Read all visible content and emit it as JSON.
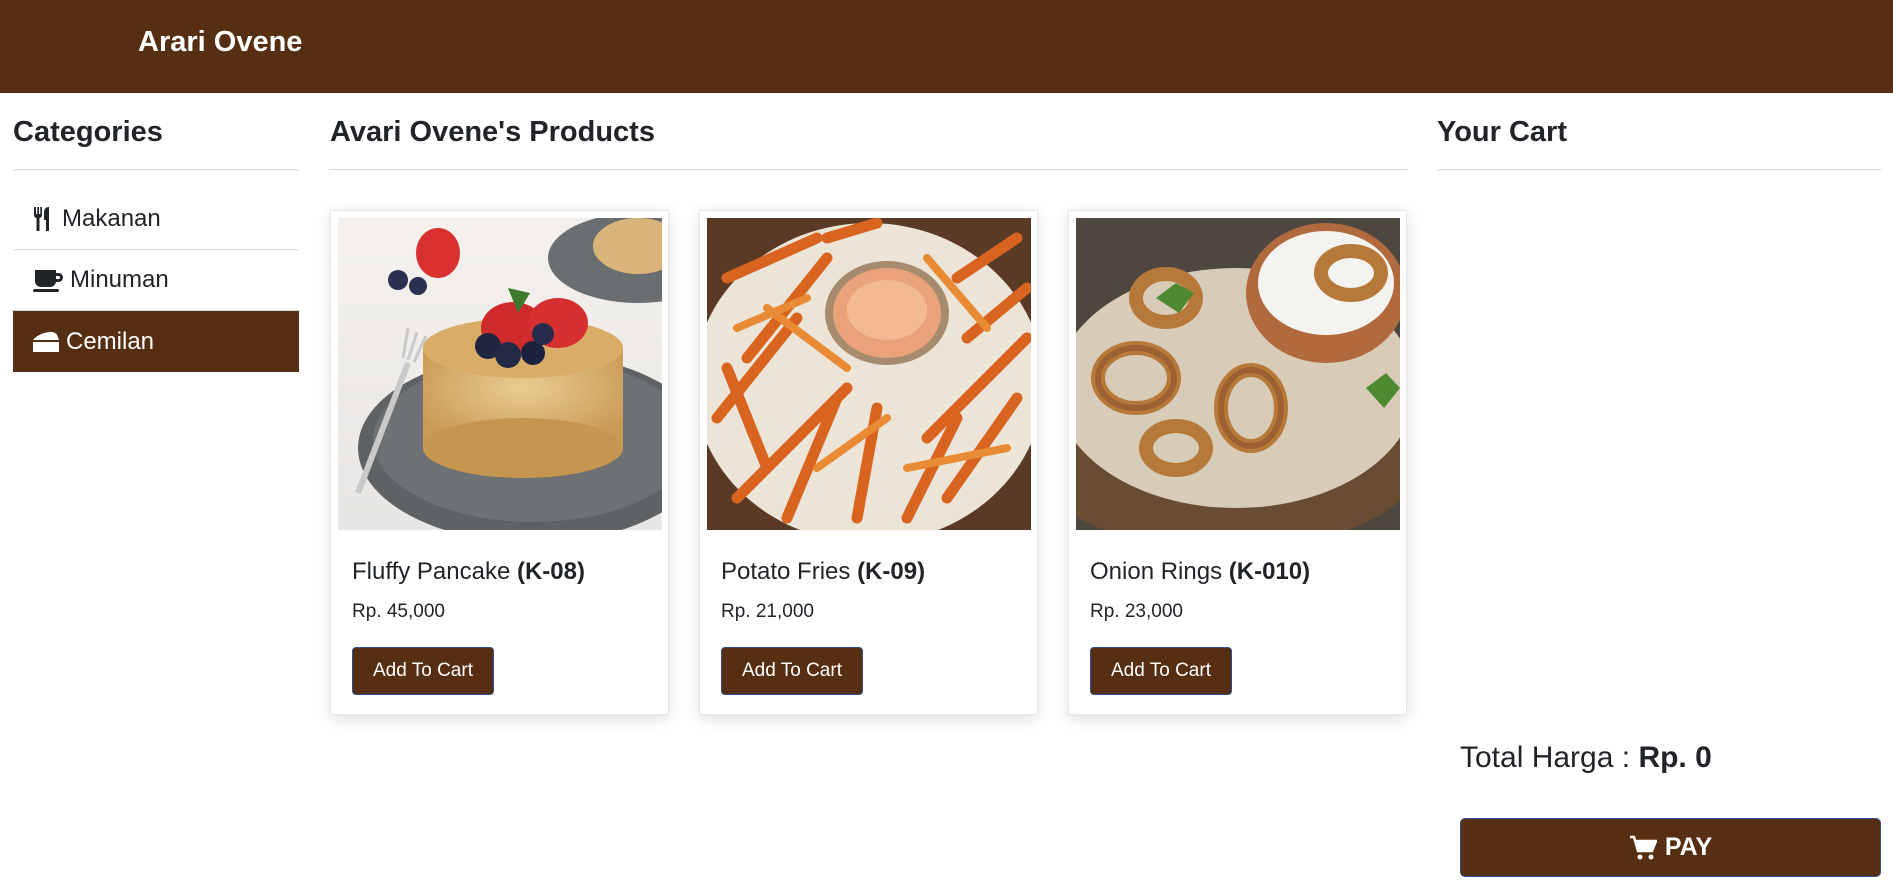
{
  "navbar": {
    "brand": "Arari Ovene"
  },
  "categories": {
    "title": "Categories",
    "items": [
      {
        "label": "Makanan",
        "icon": "utensils-icon",
        "active": false
      },
      {
        "label": "Minuman",
        "icon": "coffee-cup-icon",
        "active": false
      },
      {
        "label": "Cemilan",
        "icon": "cake-icon",
        "active": true
      }
    ]
  },
  "products": {
    "title": "Avari Ovene's Products",
    "items": [
      {
        "name": "Fluffy Pancake",
        "code": "(K-08)",
        "price": "Rp. 45,000",
        "button": "Add To Cart",
        "image": "pancake-with-berries"
      },
      {
        "name": "Potato Fries",
        "code": "(K-09)",
        "price": "Rp. 21,000",
        "button": "Add To Cart",
        "image": "fries-with-dip"
      },
      {
        "name": "Onion Rings",
        "code": "(K-010)",
        "price": "Rp. 23,000",
        "button": "Add To Cart",
        "image": "onion-rings-with-dip"
      }
    ]
  },
  "cart": {
    "title": "Your Cart",
    "total_label": "Total Harga :",
    "total_value": "Rp. 0",
    "pay_label": "PAY"
  },
  "colors": {
    "brand": "#562e11",
    "text": "#212529"
  }
}
